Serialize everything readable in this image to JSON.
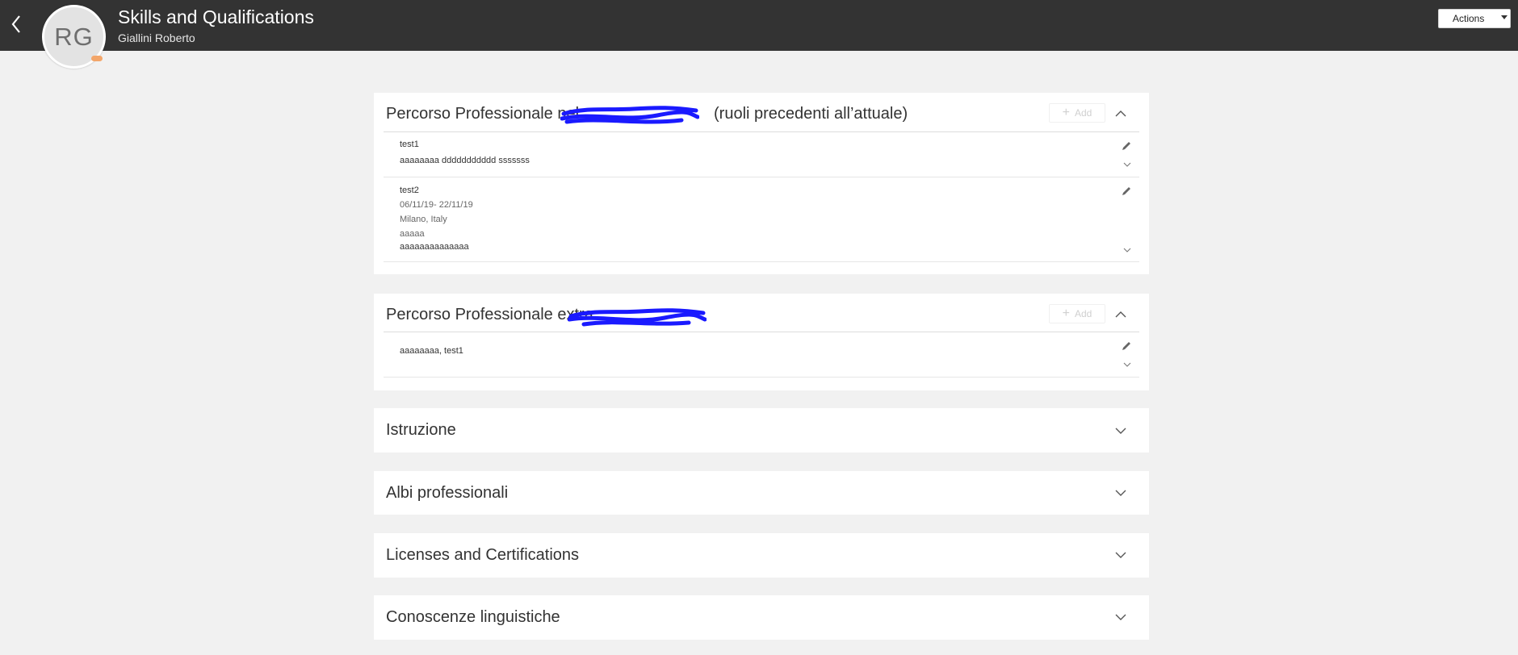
{
  "header": {
    "title": "Skills and Qualifications",
    "subtitle": "Giallini Roberto",
    "avatar_initials": "RG",
    "actions_label": "Actions",
    "back_icon": "chevron-left-icon"
  },
  "sections": [
    {
      "title_prefix": "Percorso Professionale nel",
      "title_suffix": "(ruoli precedenti all’attuale)",
      "add_label": "Add",
      "expanded": true,
      "items": [
        {
          "name": "test1",
          "lines": [
            {
              "text": "aaaaaaaa ddddddddddd sssssss",
              "style": "name"
            }
          ]
        },
        {
          "name": "test2",
          "lines": [
            {
              "text": "06/11/19- 22/11/19",
              "style": "meta"
            },
            {
              "text": "Milano, Italy",
              "style": "meta"
            },
            {
              "text": "aaaaa",
              "style": "meta"
            },
            {
              "text": "aaaaaaaaaaaaaa",
              "style": "name"
            }
          ]
        }
      ]
    },
    {
      "title_prefix": "Percorso Professionale extra",
      "title_suffix": "",
      "add_label": "Add",
      "expanded": true,
      "items": [
        {
          "name": "aaaaaaaa, test1",
          "lines": []
        }
      ]
    },
    {
      "title": "Istruzione",
      "expanded": false
    },
    {
      "title": "Albi professionali",
      "expanded": false
    },
    {
      "title": "Licenses and Certifications",
      "expanded": false
    },
    {
      "title": "Conoscenze linguistiche",
      "expanded": false
    }
  ],
  "colors": {
    "topbar": "#333333",
    "page_background": "#f1f1f1",
    "card_background": "#ffffff",
    "redaction_scribble": "#1a1aff"
  }
}
